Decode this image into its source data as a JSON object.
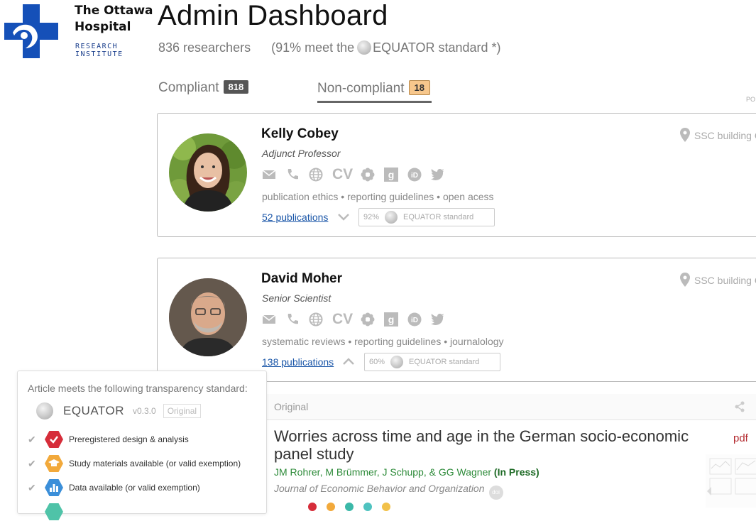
{
  "logo": {
    "name_line1": "The Ottawa",
    "name_line2": "Hospital",
    "sub_line1": "RESEARCH",
    "sub_line2": "INSTITUTE",
    "brand_color": "#1550b8"
  },
  "header": {
    "title": "Admin Dashboard",
    "researchers": "836 researchers",
    "meet_prefix": "(91% meet the",
    "meet_suffix": "EQUATOR standard *)"
  },
  "tabs": [
    {
      "label": "Compliant",
      "count": "818",
      "active": false
    },
    {
      "label": "Non-compliant",
      "count": "18",
      "active": true
    }
  ],
  "corner_text": "PO",
  "researchers": [
    {
      "name": "Kelly Cobey",
      "role": "Adjunct Professor",
      "tags": "publication ethics • reporting guidelines • open acess",
      "publications": "52 publications",
      "chevron": "chevron-down",
      "equator_percent": "92%",
      "equator_label": "EQUATOR standard",
      "location": "SSC building C"
    },
    {
      "name": "David Moher",
      "role": "Senior Scientist",
      "tags": "systematic reviews • reporting guidelines • journalology",
      "publications": "138 publications",
      "chevron": "chevron-up",
      "equator_percent": "60%",
      "equator_label": "EQUATOR standard",
      "location": "SSC building C"
    }
  ],
  "contact_icons": [
    "mail-icon",
    "phone-icon",
    "globe-icon",
    "cv-icon",
    "flower-icon",
    "google-scholar-icon",
    "orcid-icon",
    "twitter-icon"
  ],
  "cv_text": "CV",
  "popover": {
    "title": "Article meets the following transparency standard:",
    "standard_name": "EQUATOR",
    "version": "v0.3.0",
    "original_tag": "Original",
    "items": [
      {
        "label": "Preregistered design & analysis",
        "color": "#d62d3a",
        "icon": "check-badge-icon"
      },
      {
        "label": "Study materials available (or valid exemption)",
        "color": "#f2a93b",
        "icon": "graduation-cap-icon"
      },
      {
        "label": "Data available (or valid exemption)",
        "color": "#3b8fd9",
        "icon": "bar-chart-icon"
      }
    ]
  },
  "article": {
    "label": "Original",
    "title": "Worries across time and age in the German socio-economic panel study",
    "authors": "JM Rohrer, M Brümmer, J Schupp, & GG Wagner",
    "status": "(In Press)",
    "journal": "Journal of Economic Behavior and Organization",
    "doi": "doi",
    "pdf": "pdf",
    "dot_colors": [
      "#d62d3a",
      "#f2a93b",
      "#3bb8a8",
      "#4fc3c0",
      "#f2c14a"
    ]
  }
}
